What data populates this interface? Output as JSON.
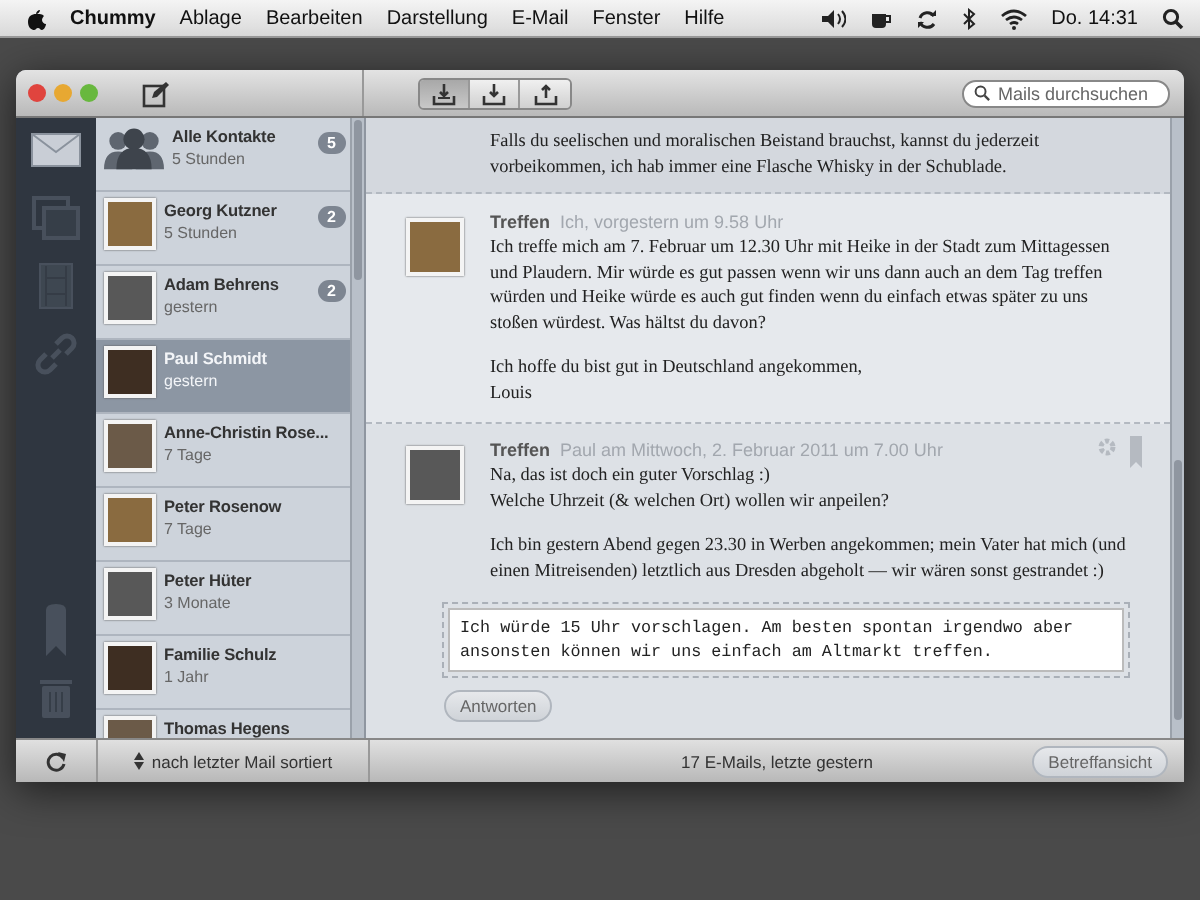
{
  "menubar": {
    "app": "Chummy",
    "menus": [
      "Ablage",
      "Bearbeiten",
      "Darstellung",
      "E-Mail",
      "Fenster",
      "Hilfe"
    ],
    "clock": "Do. 14:31"
  },
  "toolbar": {
    "segments": [
      {
        "kind": "inbox",
        "selected": true
      },
      {
        "kind": "download",
        "selected": false
      },
      {
        "kind": "upload",
        "selected": false
      }
    ],
    "search": {
      "placeholder": "Mails durchsuchen"
    }
  },
  "rail": [
    {
      "kind": "envelope",
      "selected": true
    },
    {
      "kind": "photos",
      "selected": false
    },
    {
      "kind": "film",
      "selected": false
    },
    {
      "kind": "link",
      "selected": false
    },
    {
      "kind": "bookmark",
      "selected": false
    },
    {
      "kind": "trash",
      "selected": false
    }
  ],
  "contacts": [
    {
      "kind": "group",
      "name": "Alle Kontakte",
      "time": "5 Stunden",
      "badge": "5",
      "selected": false
    },
    {
      "kind": "person",
      "name": "Georg Kutzner",
      "time": "5 Stunden",
      "badge": "2",
      "selected": false
    },
    {
      "kind": "person",
      "name": "Adam Behrens",
      "time": "gestern",
      "badge": "2",
      "selected": false
    },
    {
      "kind": "person",
      "name": "Paul Schmidt",
      "time": "gestern",
      "selected": true
    },
    {
      "kind": "person",
      "name": "Anne-Christin Rose...",
      "time": "7 Tage",
      "selected": false
    },
    {
      "kind": "person",
      "name": "Peter Rosenow",
      "time": "7 Tage",
      "selected": false
    },
    {
      "kind": "person",
      "name": "Peter Hüter",
      "time": "3 Monate",
      "selected": false
    },
    {
      "kind": "person",
      "name": "Familie Schulz",
      "time": "1 Jahr",
      "selected": false
    },
    {
      "kind": "person",
      "name": "Thomas Hegens",
      "selected": false
    }
  ],
  "messages": [
    {
      "kind": "tail",
      "paragraphs": [
        "Falls du seelischen und moralischen Beistand brauchst, kannst du jederzeit vorbeikommen, ich hab immer eine Flasche Whisky in der Schublade."
      ]
    },
    {
      "kind": "full",
      "subject": "Treffen",
      "meta": "Ich, vorgestern um 9.58 Uhr",
      "paragraphs": [
        "Ich treffe mich am 7. Februar um 12.30 Uhr mit Heike in der Stadt zum Mittagessen und Plaudern. Mir würde es gut passen wenn wir uns dann auch an dem Tag treffen würden und Heike würde es auch gut finden wenn du einfach etwas später zu uns stoßen würdest. Was hältst du davon?",
        "Ich hoffe du bist gut in Deutschland angekommen,\nLouis"
      ]
    },
    {
      "kind": "reply",
      "subject": "Treffen",
      "meta": "Paul am Mittwoch, 2. Februar 2011 um 7.00 Uhr",
      "paragraphs": [
        "Na, das ist doch ein guter Vorschlag :)\nWelche Uhrzeit (& welchen Ort) wollen wir anpeilen?",
        "Ich bin gestern Abend gegen 23.30 in Werben angekommen; mein Vater hat mich (und einen Mitreisenden) letztlich aus Dresden abgeholt — wir wären sonst gestrandet :)"
      ],
      "reply_value": "Ich würde 15 Uhr vorschlagen. Am besten spontan irgendwo aber ansonsten können wir uns einfach am Altmarkt treffen.",
      "button": "Antworten"
    }
  ],
  "status_bar": {
    "sort": "nach letzter Mail sortiert",
    "count": "17 E-Mails, letzte gestern",
    "button": "Betreffansicht"
  }
}
